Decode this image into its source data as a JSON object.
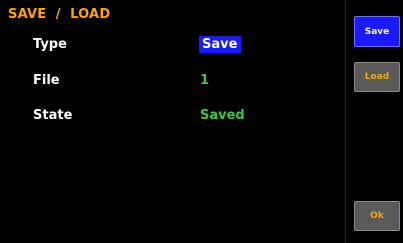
{
  "title": "SAVE  /  LOAD",
  "rows": [
    {
      "label": "Type",
      "value": "Save"
    },
    {
      "label": "File",
      "value": "1"
    },
    {
      "label": "State",
      "value": "Saved"
    }
  ],
  "buttons": {
    "save": "Save",
    "load": "Load",
    "ok": "Ok"
  },
  "colors": {
    "title": "#ffa500",
    "accent_blue": "#1a1aff",
    "value_green": "#33cc33",
    "button_gray": "#5a5a5a"
  }
}
